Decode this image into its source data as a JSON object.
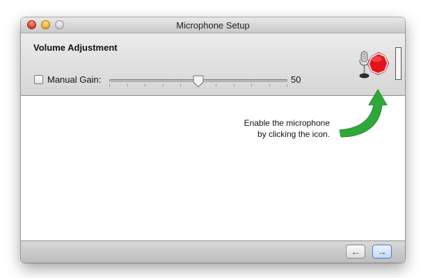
{
  "window": {
    "title": "Microphone Setup",
    "controls": [
      "close",
      "minimize",
      "zoom"
    ]
  },
  "settings": {
    "section_title": "Volume Adjustment",
    "manual_gain": {
      "label": "Manual Gain:",
      "checked": false
    },
    "gain_slider": {
      "min": 0,
      "max": 100,
      "value": 50,
      "value_label": "50"
    },
    "mic_status_icon": "microphone-stop-icon",
    "level_meter_value": 0
  },
  "hint": {
    "line1": "Enable the microphone",
    "line2": "by clicking the icon.",
    "arrow_icon": "curved-arrow-icon"
  },
  "navigation": {
    "back_icon": "arrow-left-icon",
    "forward_icon": "arrow-right-icon",
    "back_glyph": "←",
    "forward_glyph": "→"
  },
  "colors": {
    "stop_red": "#e0141a",
    "arrow_green": "#2fa83a",
    "focus_blue": "#4a7dc8"
  }
}
